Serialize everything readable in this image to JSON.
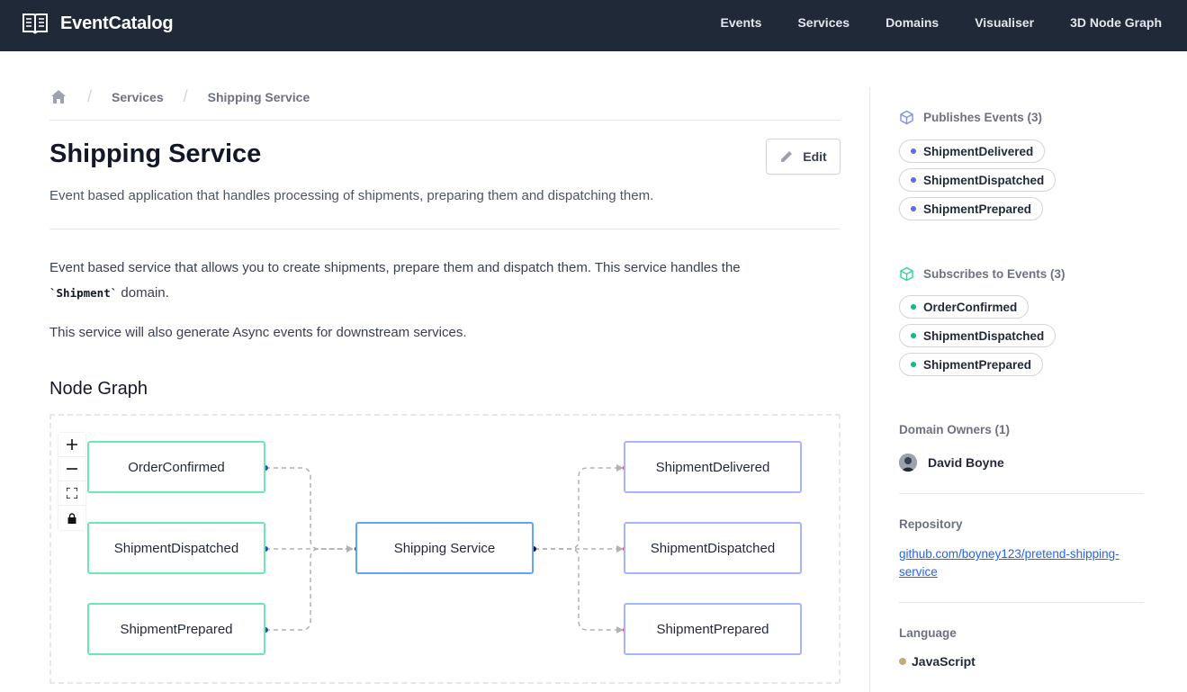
{
  "header": {
    "brand": "EventCatalog",
    "nav": [
      "Events",
      "Services",
      "Domains",
      "Visualiser",
      "3D Node Graph"
    ]
  },
  "breadcrumb": {
    "items": [
      "Services",
      "Shipping Service"
    ]
  },
  "page": {
    "title": "Shipping Service",
    "edit_label": "Edit",
    "summary": "Event based application that handles processing of shipments, preparing them and dispatching them.",
    "body_p1_a": "Event based service that allows you to create shipments, prepare them and dispatch them. This service handles the",
    "body_p1_code": "`Shipment`",
    "body_p1_b": " domain.",
    "body_p2": "This service will also generate Async events for downstream services.",
    "node_graph_heading": "Node Graph"
  },
  "graph": {
    "controls": [
      "zoom-in",
      "zoom-out",
      "fit-view",
      "lock"
    ],
    "subscribes": [
      "OrderConfirmed",
      "ShipmentDispatched",
      "ShipmentPrepared"
    ],
    "service": "Shipping Service",
    "publishes": [
      "ShipmentDelivered",
      "ShipmentDispatched",
      "ShipmentPrepared"
    ],
    "colors": {
      "subscribe_border": "#6ee7b7",
      "service_border": "#60a5fa",
      "publish_border": "#a5b4fc",
      "edge": "#b1b1b7"
    }
  },
  "sidebar": {
    "publishes_heading": "Publishes Events (3)",
    "publishes": [
      "ShipmentDelivered",
      "ShipmentDispatched",
      "ShipmentPrepared"
    ],
    "subscribes_heading": "Subscribes to Events (3)",
    "subscribes": [
      "OrderConfirmed",
      "ShipmentDispatched",
      "ShipmentPrepared"
    ],
    "owners_heading": "Domain Owners (1)",
    "owner": "David Boyne",
    "repository_heading": "Repository",
    "repository_link": "github.com/boyney123/pretend-shipping-service",
    "language_heading": "Language",
    "language": "JavaScript",
    "colors": {
      "publish_dot": "#6366f1",
      "subscribe_dot": "#10b981",
      "javascript_dot": "#c8a97e"
    }
  }
}
